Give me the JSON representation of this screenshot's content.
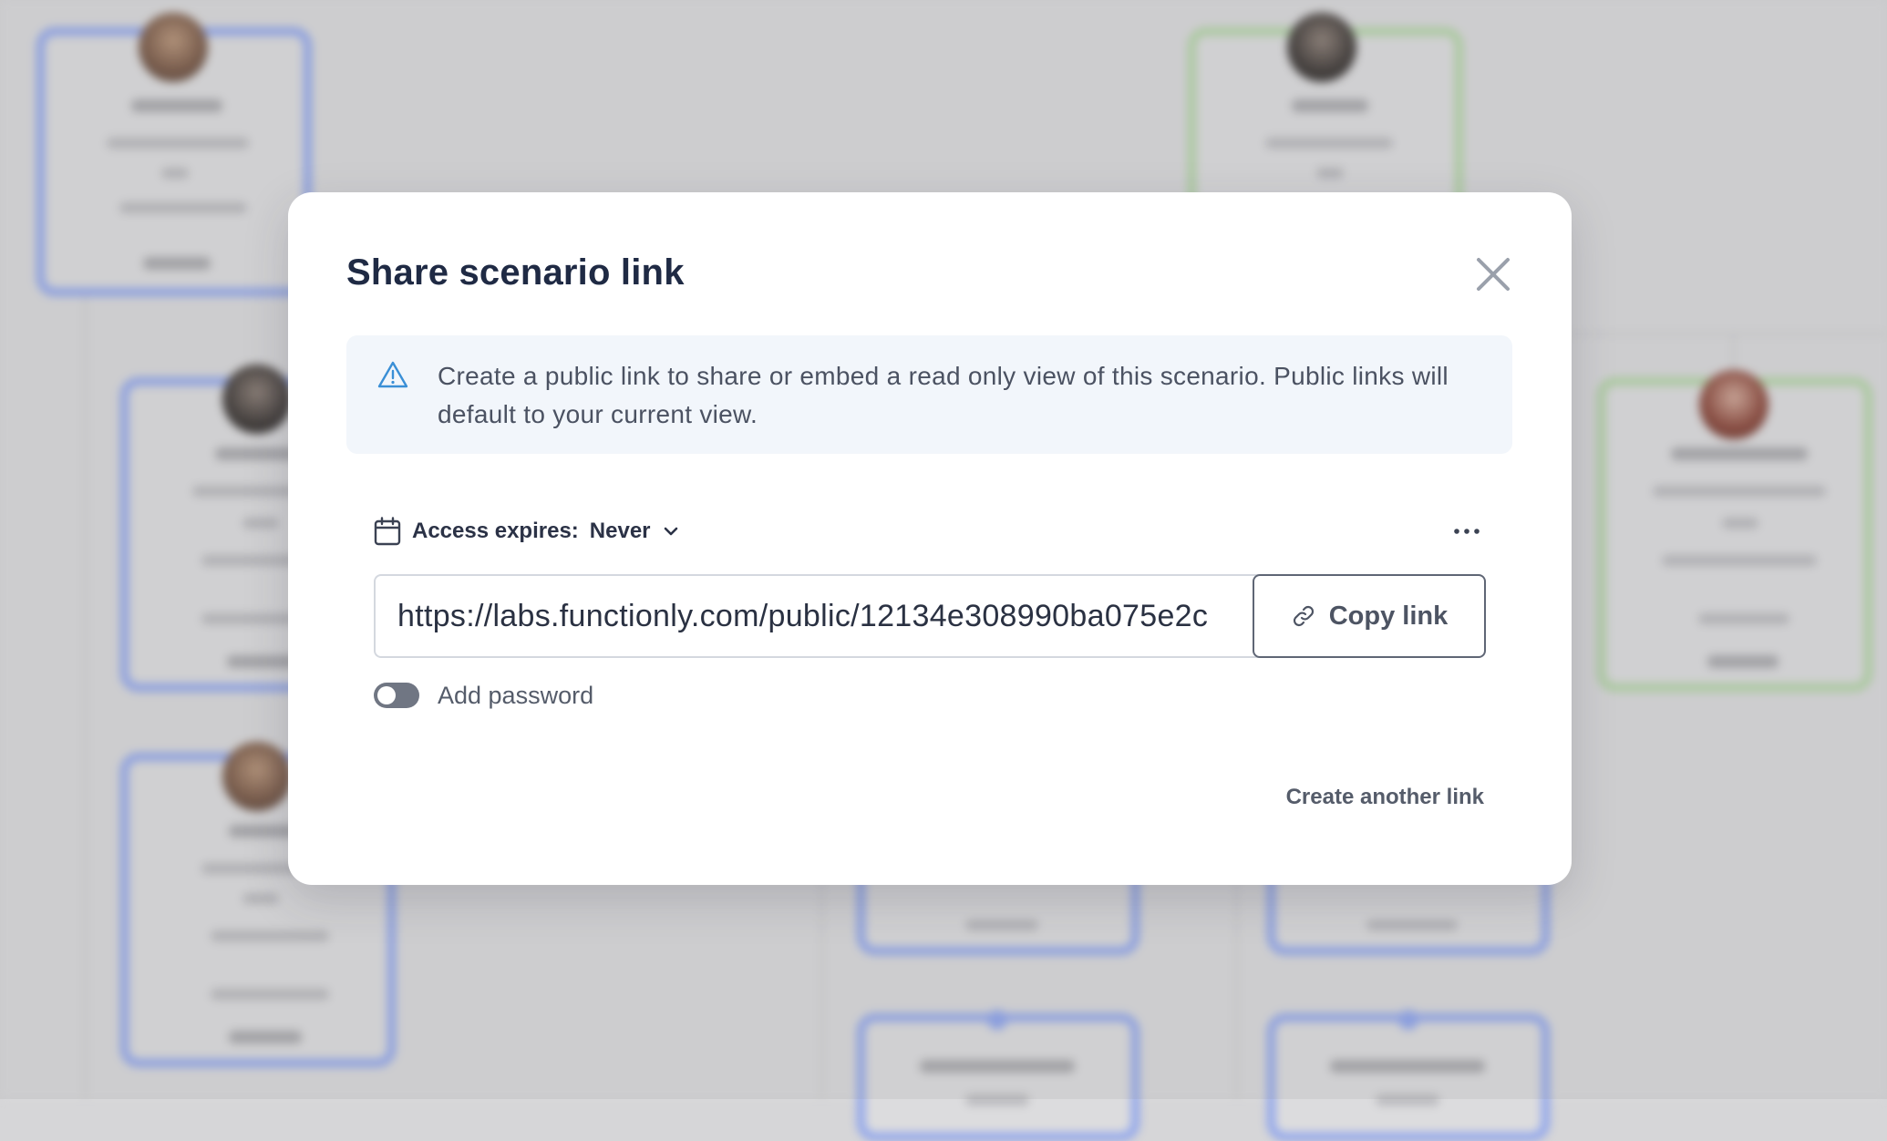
{
  "modal": {
    "title": "Share scenario link",
    "info_text": "Create a public link to share or embed a read only view of this scenario. Public links will default to your current view.",
    "access_expires_label": "Access expires:",
    "access_expires_value": "Never",
    "url": "https://labs.functionly.com/public/12134e308990ba075e2c",
    "copy_label": "Copy link",
    "password_label": "Add password",
    "password_enabled": false,
    "create_another_label": "Create another link"
  },
  "icons": {
    "close": "close-icon",
    "warning": "warning-triangle-icon",
    "calendar": "calendar-icon",
    "chevron": "chevron-down-icon",
    "more": "more-horizontal-icon",
    "link": "link-icon"
  },
  "colors": {
    "card_blue": "#8ea4ec",
    "card_green": "#b1d3a4",
    "info_background": "#f2f6fb",
    "title_text": "#1f2a44",
    "info_icon": "#3a8fd6"
  }
}
